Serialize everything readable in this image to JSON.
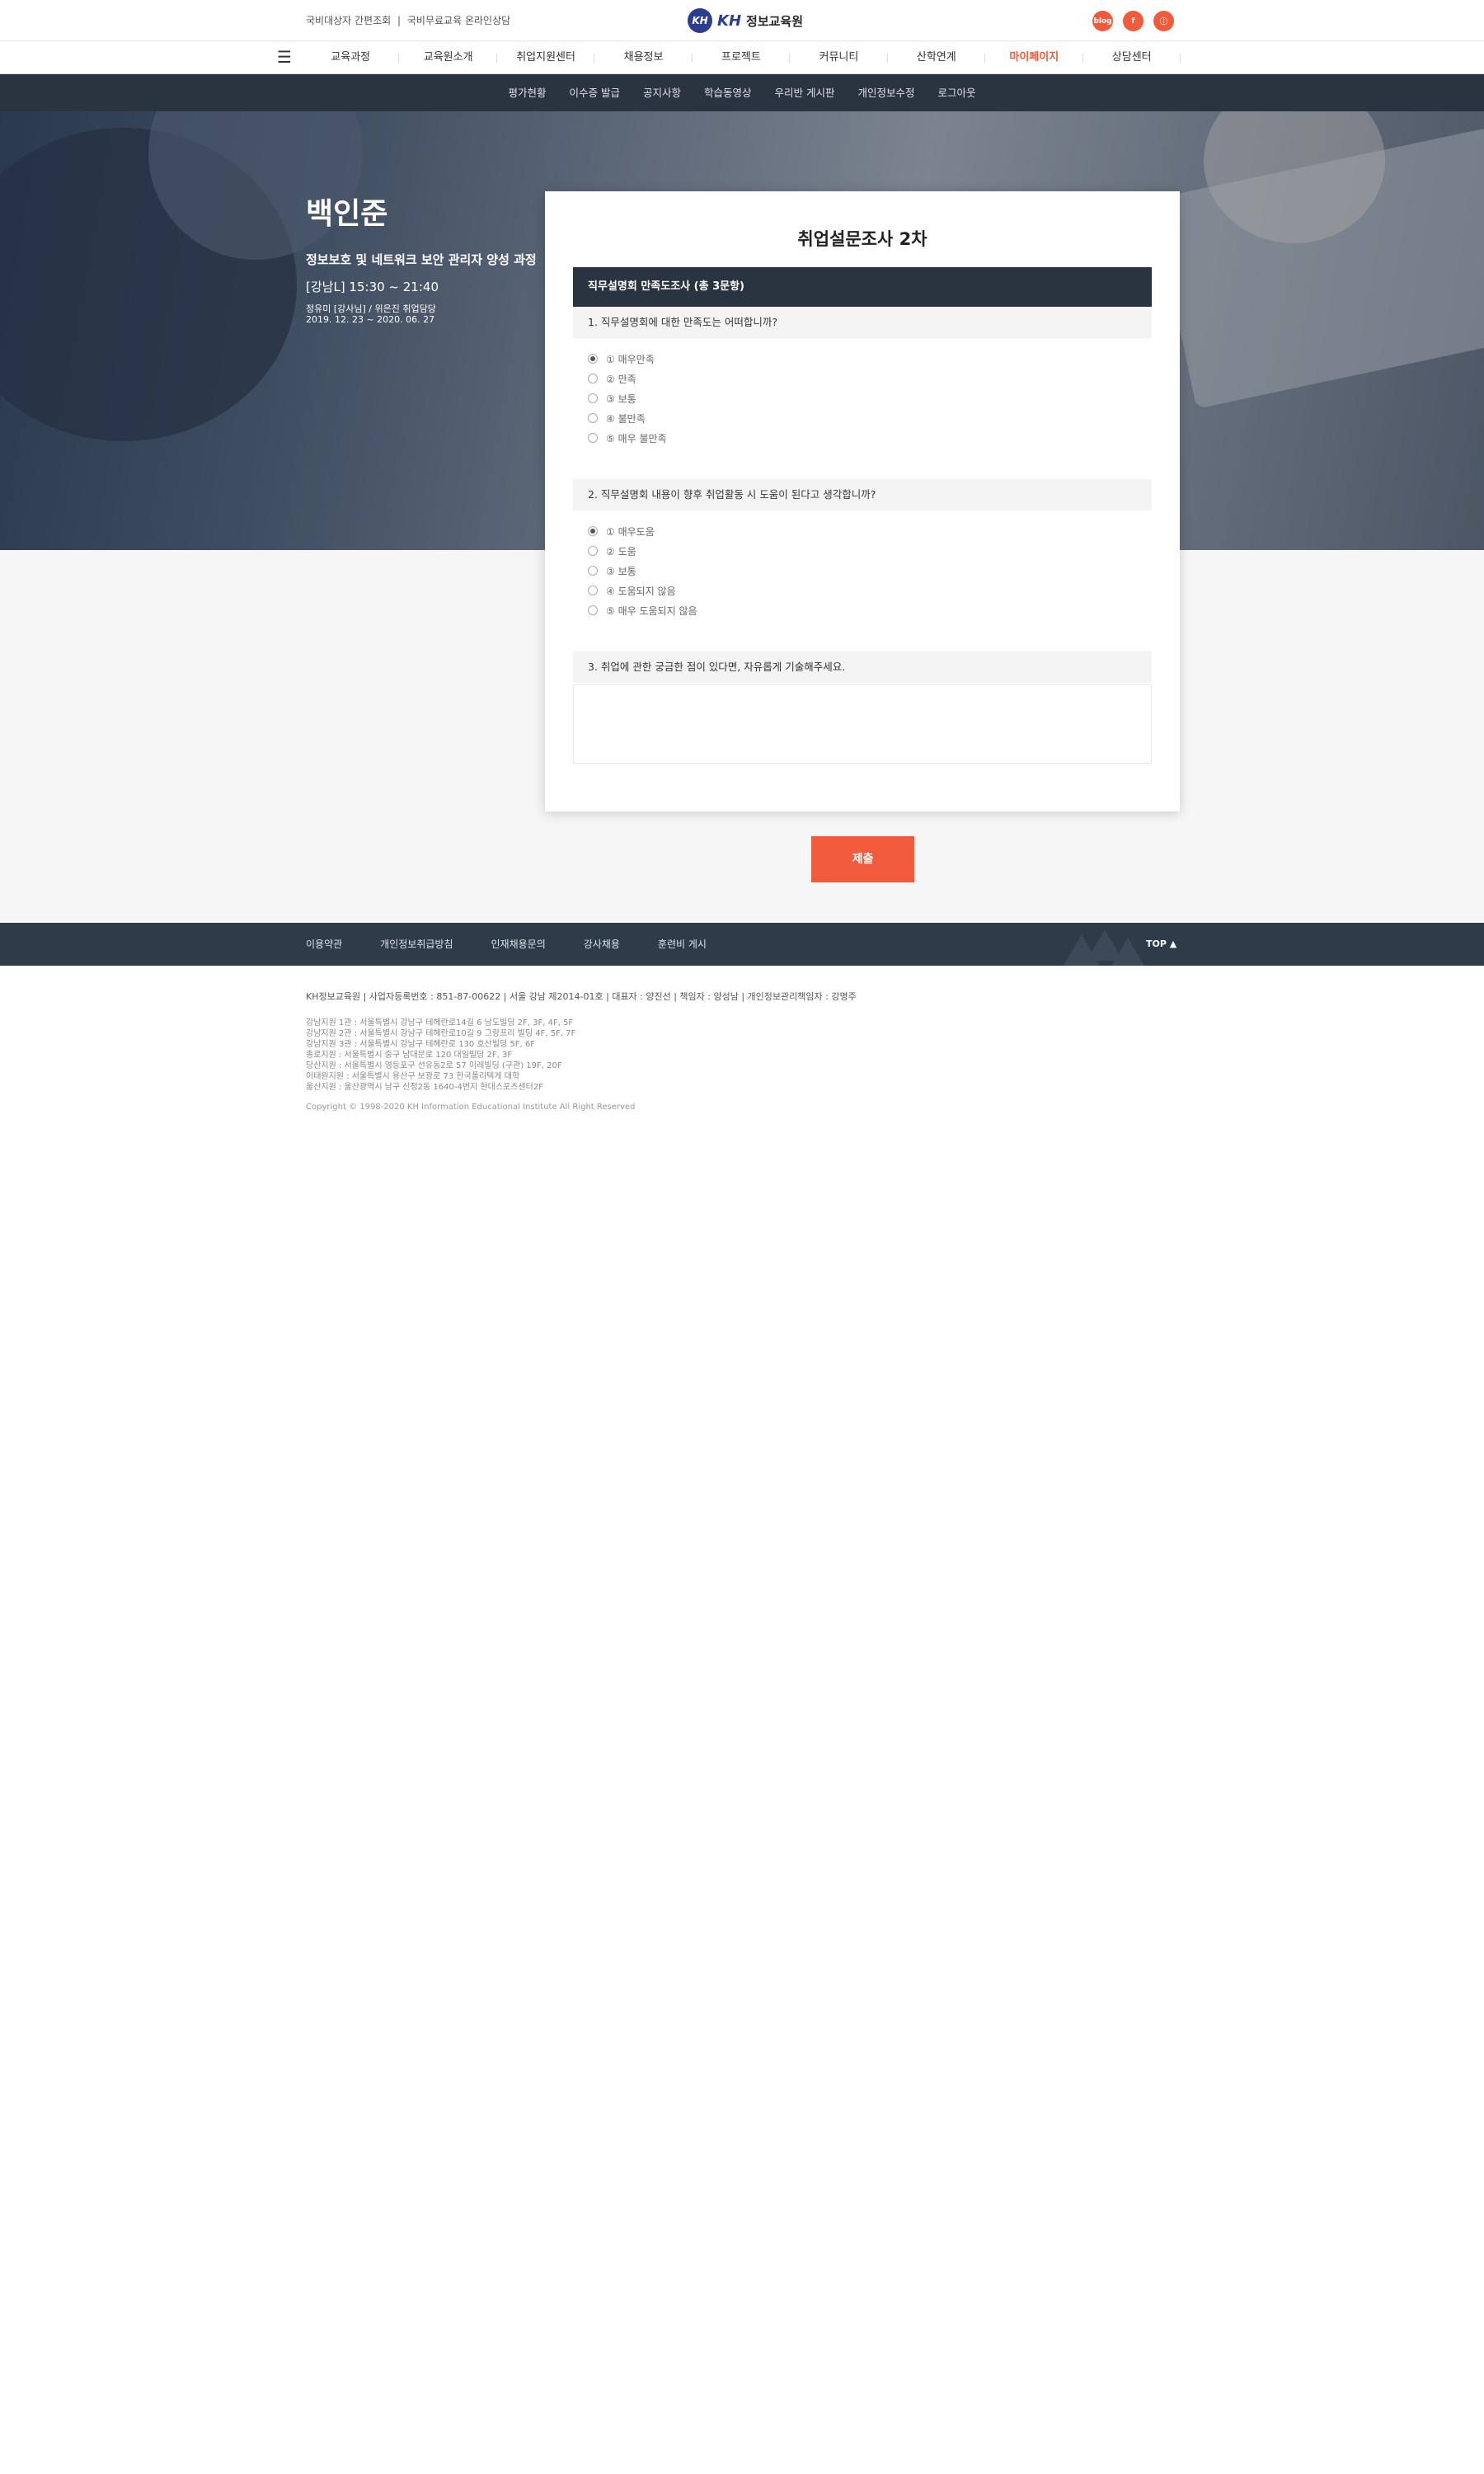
{
  "top": {
    "links": [
      "국비대상자 간편조회",
      "|",
      "국비무료교육 온라인상담"
    ],
    "logo_mark": "KH",
    "logo_brand": "KH",
    "logo_text": "정보교육원",
    "social": [
      "blog",
      "f",
      "ⓘ"
    ]
  },
  "nav": {
    "menu_icon": "☰",
    "items": [
      "교육과정",
      "교육원소개",
      "취업지원센터",
      "채용정보",
      "프로젝트",
      "커뮤니티",
      "산학연계",
      "마이페이지",
      "상담센터"
    ],
    "active_index": 7
  },
  "subnav": {
    "items": [
      "평가현황",
      "이수증 발급",
      "공지사항",
      "학습동영상",
      "우리반 게시판",
      "개인정보수정",
      "로그아웃"
    ]
  },
  "profile": {
    "name": "백인준",
    "course": "정보보호 및 네트워크 보안 관리자 양성 과정",
    "time": "[강남L] 15:30 ~ 21:40",
    "teacher": "정유미 [강사님] / 위은진 취업담당",
    "period": "2019. 12. 23 ~ 2020. 06. 27"
  },
  "survey": {
    "title": "취업설문조사 2차",
    "section_header": "직무설명회 만족도조사 (총 3문항)",
    "questions": [
      {
        "text": "1. 직무설명회에 대한 만족도는 어떠합니까?",
        "options": [
          "① 매우만족",
          "② 만족",
          "③ 보통",
          "④ 불만족",
          "⑤ 매우 불만족"
        ],
        "selected": 0
      },
      {
        "text": "2. 직무설명회 내용이 향후 취업활동 시 도움이 된다고 생각합니까?",
        "options": [
          "① 매우도움",
          "② 도움",
          "③ 보통",
          "④ 도움되지 않음",
          "⑤ 매우 도움되지 않음"
        ],
        "selected": 0
      },
      {
        "text": "3. 취업에 관한 궁금한 점이 있다면, 자유롭게 기술해주세요.",
        "answer_value": ""
      }
    ],
    "submit_label": "제출"
  },
  "footer": {
    "links": [
      "이용약관",
      "개인정보취급방침",
      "인재채용문의",
      "강사채용",
      "훈련비 게시"
    ],
    "top_label": "TOP ▲",
    "biz_info": "KH정보교육원  |  사업자등록번호 : 851-87-00622  |  서울 강남 제2014-01호  |  대표자 : 양진선  |  책임자 : 양성남  |  개인정보관리책임자 : 강명주",
    "addresses": [
      "강남지원 1관 : 서울특별시 강남구 테헤란로14길 6 남도빌딩 2F, 3F, 4F, 5F",
      "강남지원 2관 : 서울특별시 강남구 테헤란로10길 9 그랑프리 빌딩 4F, 5F, 7F",
      "강남지원 3관 : 서울특별시 강남구 테헤란로 130 호산빌딩 5F, 6F",
      "종로지원 : 서울특별시 중구 남대문로 120 대일빌딩 2F, 3F",
      "당산지원 : 서울특별시 영등포구 선유동2로 57 이레빌딩 (구관) 19F, 20F",
      "이태원지원 : 서울특별시 용산구 보광로 73 한국폴리텍게 대학",
      "울산지원 : 울산광역시 남구 신정2동 1640-4번지 현대스포츠센터2F"
    ],
    "copyright": "Copyright © 1998-2020 KH Information Educational Institute All Right Reserved"
  }
}
